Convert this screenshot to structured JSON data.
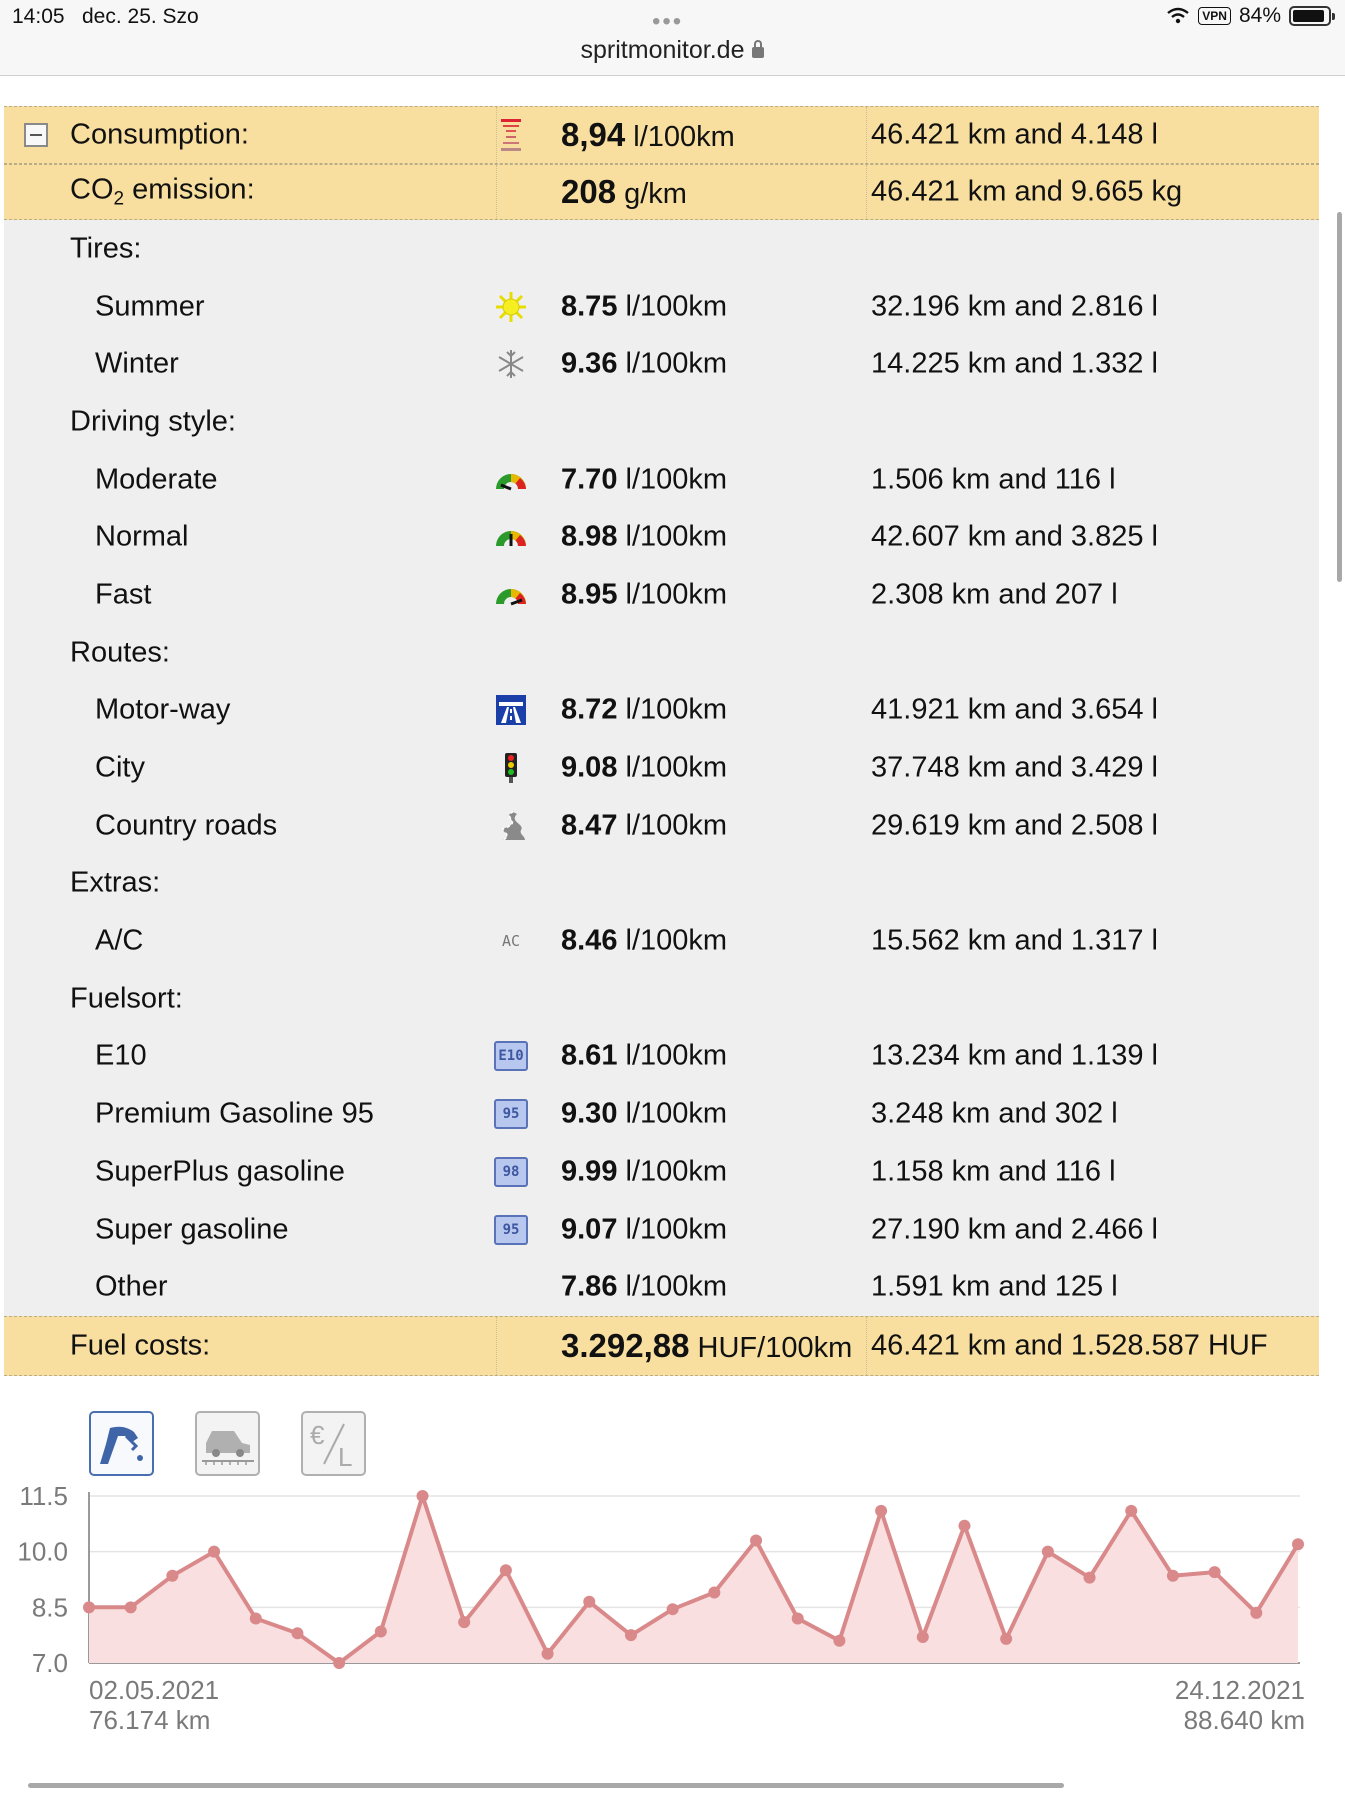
{
  "status_bar": {
    "time": "14:05",
    "date": "dec. 25. Szo",
    "vpn": "VPN",
    "battery": "84%",
    "url": "spritmonitor.de"
  },
  "summary": {
    "consumption": {
      "label": "Consumption:",
      "value": "8,94",
      "unit": "l/100km",
      "detail": "46.421 km and 4.148 l"
    },
    "co2": {
      "label_pre": "CO",
      "label_sub": "2",
      "label_post": " emission:",
      "value": "208",
      "unit": "g/km",
      "detail": "46.421 km and 9.665 kg"
    },
    "fuel_costs": {
      "label": "Fuel costs:",
      "value": "3.292,88",
      "unit": "HUF/100km",
      "detail": "46.421 km and 1.528.587 HUF"
    }
  },
  "sections": {
    "tires": {
      "label": "Tires:",
      "items": [
        {
          "label": "Summer",
          "value": "8.75",
          "unit": "l/100km",
          "detail": "32.196 km and 2.816 l",
          "icon": "sun-icon"
        },
        {
          "label": "Winter",
          "value": "9.36",
          "unit": "l/100km",
          "detail": "14.225 km and 1.332 l",
          "icon": "snowflake-icon"
        }
      ]
    },
    "driving": {
      "label": "Driving style:",
      "items": [
        {
          "label": "Moderate",
          "value": "7.70",
          "unit": "l/100km",
          "detail": "1.506 km and 116 l",
          "icon": "gauge-low-icon"
        },
        {
          "label": "Normal",
          "value": "8.98",
          "unit": "l/100km",
          "detail": "42.607 km and 3.825 l",
          "icon": "gauge-mid-icon"
        },
        {
          "label": "Fast",
          "value": "8.95",
          "unit": "l/100km",
          "detail": "2.308 km and 207 l",
          "icon": "gauge-high-icon"
        }
      ]
    },
    "routes": {
      "label": "Routes:",
      "items": [
        {
          "label": "Motor-way",
          "value": "8.72",
          "unit": "l/100km",
          "detail": "41.921 km and 3.654 l",
          "icon": "motorway-icon"
        },
        {
          "label": "City",
          "value": "9.08",
          "unit": "l/100km",
          "detail": "37.748 km and 3.429 l",
          "icon": "traffic-light-icon"
        },
        {
          "label": "Country roads",
          "value": "8.47",
          "unit": "l/100km",
          "detail": "29.619 km and 2.508 l",
          "icon": "winding-road-icon"
        }
      ]
    },
    "extras": {
      "label": "Extras:",
      "items": [
        {
          "label": "A/C",
          "value": "8.46",
          "unit": "l/100km",
          "detail": "15.562 km and 1.317 l",
          "icon": "ac-icon",
          "icon_text": "AC"
        }
      ]
    },
    "fuelsort": {
      "label": "Fuelsort:",
      "items": [
        {
          "label": "E10",
          "value": "8.61",
          "unit": "l/100km",
          "detail": "13.234 km and 1.139 l",
          "icon": "e10-badge-icon",
          "icon_text": "E10"
        },
        {
          "label": "Premium Gasoline 95",
          "value": "9.30",
          "unit": "l/100km",
          "detail": "3.248 km and 302 l",
          "icon": "fuel-95-badge-icon",
          "icon_text": "95"
        },
        {
          "label": "SuperPlus gasoline",
          "value": "9.99",
          "unit": "l/100km",
          "detail": "1.158 km and 116 l",
          "icon": "fuel-98-badge-icon",
          "icon_text": "98"
        },
        {
          "label": "Super gasoline",
          "value": "9.07",
          "unit": "l/100km",
          "detail": "27.190 km and 2.466 l",
          "icon": "fuel-95-badge-icon",
          "icon_text": "95"
        },
        {
          "label": "Other",
          "value": "7.86",
          "unit": "l/100km",
          "detail": "1.591 km and 125 l",
          "icon": ""
        }
      ]
    }
  },
  "chart_tabs": [
    {
      "name": "fuel-pump-tab",
      "active": true
    },
    {
      "name": "car-distance-tab",
      "active": false
    },
    {
      "name": "euro-per-liter-tab",
      "active": false
    }
  ],
  "chart_data": {
    "type": "area",
    "yticks": [
      "11.5",
      "10.0",
      "8.5",
      "7.0"
    ],
    "ylim": [
      7.0,
      11.5
    ],
    "x_start": {
      "date": "02.05.2021",
      "km": "76.174 km"
    },
    "x_end": {
      "date": "24.12.2021",
      "km": "88.640 km"
    },
    "values": [
      8.5,
      8.5,
      9.35,
      10.0,
      8.2,
      7.8,
      7.0,
      7.85,
      11.5,
      8.1,
      9.5,
      7.25,
      8.65,
      7.75,
      8.45,
      8.9,
      10.3,
      8.2,
      7.6,
      11.1,
      7.7,
      10.7,
      7.65,
      10.0,
      9.3,
      11.1,
      9.35,
      9.45,
      8.35,
      10.2
    ],
    "colors": {
      "line": "#d9898a",
      "fill": "#f9dfe0",
      "marker": "#d9898a"
    }
  }
}
